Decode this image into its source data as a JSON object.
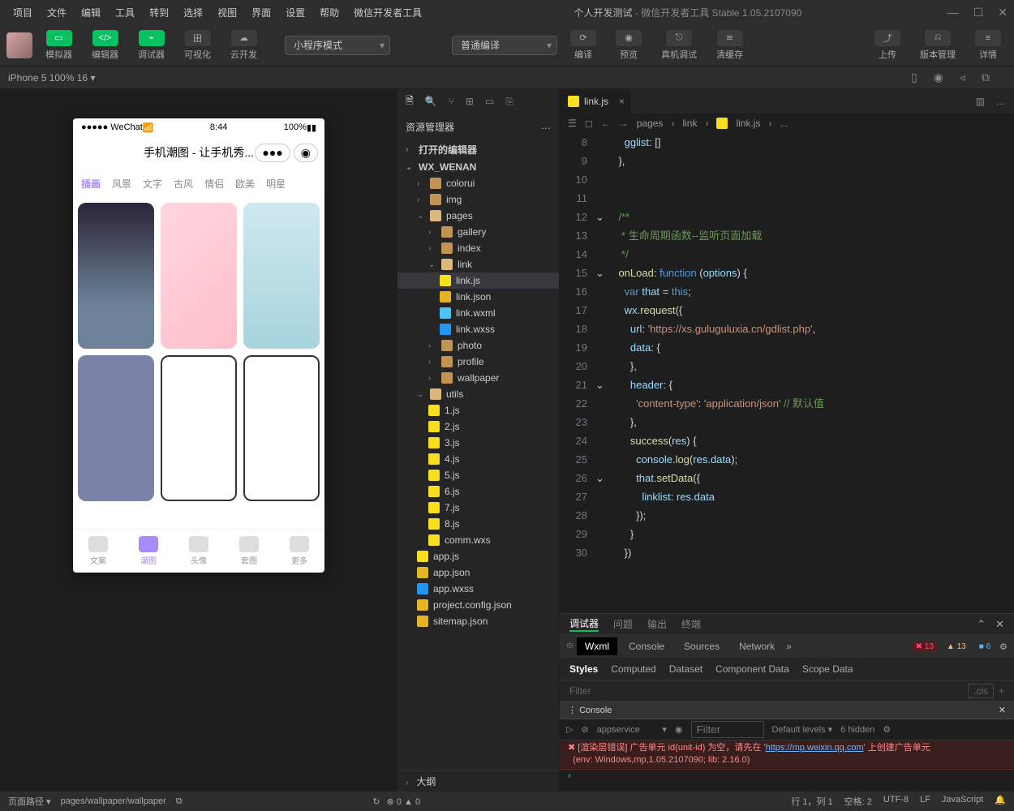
{
  "menubar": [
    "项目",
    "文件",
    "编辑",
    "工具",
    "转到",
    "选择",
    "视图",
    "界面",
    "设置",
    "帮助",
    "微信开发者工具"
  ],
  "title_app": "个人开发测试",
  "title_suffix": " - 微信开发者工具 Stable 1.05.2107090",
  "toolbar": {
    "simulator": "模拟器",
    "editor": "编辑器",
    "debugger": "调试器",
    "visual": "可视化",
    "cloud": "云开发",
    "mode_select": "小程序模式",
    "compile_select": "普通编译",
    "compile": "编译",
    "preview": "预览",
    "realdebug": "真机调试",
    "clearcache": "清缓存",
    "upload": "上传",
    "version": "版本管理",
    "details": "详情"
  },
  "device": {
    "label": "iPhone 5 100% 16",
    "suffix": "▾"
  },
  "phone": {
    "carrier": "●●●●● WeChat",
    "wifi": "📶",
    "time": "8:44",
    "battery": "100%",
    "title": "手机潮图 - 让手机秀...",
    "tabs": [
      "插画",
      "风景",
      "文字",
      "古风",
      "情侣",
      "欧美",
      "明星"
    ],
    "nav": [
      "文案",
      "潮图",
      "头像",
      "套图",
      "更多"
    ]
  },
  "explorer": {
    "header": "资源管理器",
    "s1": "打开的编辑器",
    "root": "WX_WENAN",
    "items": {
      "colorui": "colorui",
      "img": "img",
      "pages": "pages",
      "gallery": "gallery",
      "index": "index",
      "link": "link",
      "linkjs": "link.js",
      "linkjson": "link.json",
      "linkwxml": "link.wxml",
      "linkwxss": "link.wxss",
      "photo": "photo",
      "profile": "profile",
      "wallpaper": "wallpaper",
      "utils": "utils",
      "u1": "1.js",
      "u2": "2.js",
      "u3": "3.js",
      "u4": "4.js",
      "u5": "5.js",
      "u6": "6.js",
      "u7": "7.js",
      "u8": "8.js",
      "commwxs": "comm.wxs",
      "appjs": "app.js",
      "appjson": "app.json",
      "appwxss": "app.wxss",
      "projectconfig": "project.config.json",
      "sitemap": "sitemap.json"
    },
    "outline": "大纲"
  },
  "tabs": {
    "active": "link.js"
  },
  "breadcrumb": [
    "pages",
    "link",
    "link.js",
    "..."
  ],
  "code": {
    "l8": "      gglist: []",
    "l9": "    },",
    "l10": "",
    "l11": "",
    "l12": "    /**",
    "l13": "     * 生命周期函数--监听页面加载",
    "l14": "     */",
    "l15": "    onLoad: function (options) {",
    "l16": "      var that = this;",
    "l17": "      wx.request({",
    "l18": "        url: 'https://xs.guluguluxia.cn/gdlist.php',",
    "l19": "        data: {",
    "l20": "        },",
    "l21": "        header: {",
    "l22": "          'content-type': 'application/json' // 默认值",
    "l23": "        },",
    "l24": "        success(res) {",
    "l25": "          console.log(res.data);",
    "l26": "          that.setData({",
    "l27": "            linklist: res.data",
    "l28": "          });",
    "l29": "        }",
    "l30": "      })"
  },
  "debugger": {
    "tabs": [
      "调试器",
      "问题",
      "输出",
      "终端"
    ],
    "devtools": [
      "Wxml",
      "Console",
      "Sources",
      "Network"
    ],
    "errors": "13",
    "warnings": "13",
    "info": "6",
    "style_tabs": [
      "Styles",
      "Computed",
      "Dataset",
      "Component Data",
      "Scope Data"
    ],
    "filter_placeholder": "Filter",
    "cls": ".cls",
    "console_title": "Console",
    "scope": "appservice",
    "levels": "Default levels",
    "hidden": "6 hidden",
    "msg1": "[渲染层错误] 广告单元 id(unit-id) 为空，请先在 '",
    "msg1_url": "https://mp.weixin.qq.com",
    "msg1_end": "' 上创建广告单元",
    "msg2": "(env: Windows,mp,1.05.2107090; lib: 2.16.0)"
  },
  "statusbar": {
    "path_label": "页面路径 ▾",
    "path": "pages/wallpaper/wallpaper",
    "en_zero1": "0",
    "en_zero2": "0",
    "line": "行 1，列 1",
    "spaces": "空格: 2",
    "encoding": "UTF-8",
    "eol": "LF",
    "lang": "JavaScript"
  }
}
